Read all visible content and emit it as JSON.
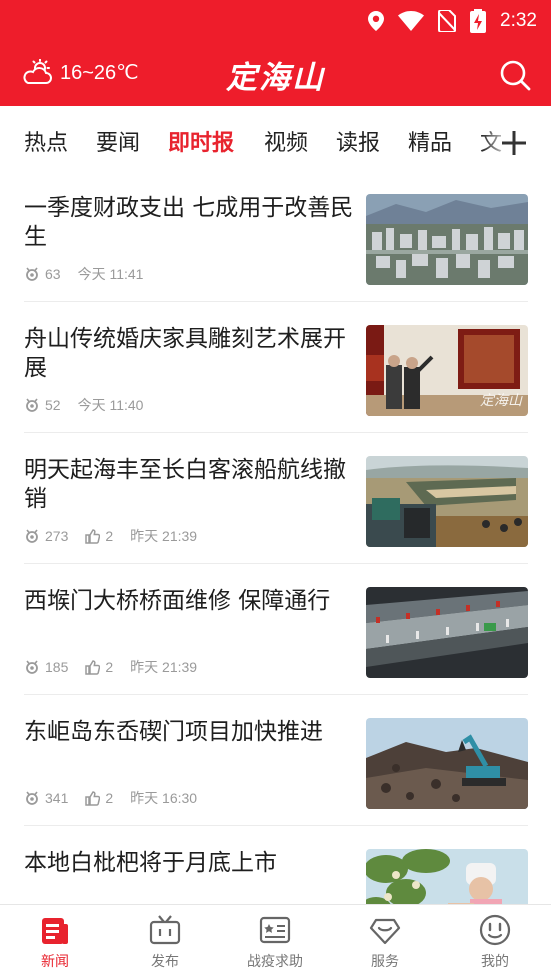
{
  "status_bar": {
    "time": "2:32"
  },
  "header": {
    "weather_text": "16~26℃",
    "brand": "定海山",
    "search_icon": "search-icon"
  },
  "tabs": [
    {
      "label": "热点",
      "active": false
    },
    {
      "label": "要闻",
      "active": false
    },
    {
      "label": "即时报",
      "active": true
    },
    {
      "label": "视频",
      "active": false
    },
    {
      "label": "读报",
      "active": false
    },
    {
      "label": "精品",
      "active": false
    },
    {
      "label": "文",
      "active": false
    }
  ],
  "feed": [
    {
      "title": "一季度财政支出 七成用于改善民生",
      "views": "63",
      "likes": null,
      "time": "今天 11:41",
      "thumb": "city-aerial-photo"
    },
    {
      "title": "舟山传统婚庆家具雕刻艺术展开展",
      "views": "52",
      "likes": null,
      "time": "今天 11:40",
      "thumb": "exhibition-photo",
      "watermark": "定海山"
    },
    {
      "title": "明天起海丰至长白客滚船航线撤销",
      "views": "273",
      "likes": "2",
      "time": "昨天 21:39",
      "thumb": "ferry-photo"
    },
    {
      "title": "西堠门大桥桥面维修 保障通行",
      "views": "185",
      "likes": "2",
      "time": "昨天 21:39",
      "thumb": "bridge-photo"
    },
    {
      "title": "东岠岛东岙碶门项目加快推进",
      "views": "341",
      "likes": "2",
      "time": "昨天 16:30",
      "thumb": "excavator-photo"
    },
    {
      "title": "本地白枇杷将于月底上市",
      "views": "",
      "likes": null,
      "time": "",
      "thumb": "loquat-photo"
    }
  ],
  "bottom_nav": [
    {
      "label": "新闻",
      "icon": "news-icon",
      "active": true
    },
    {
      "label": "发布",
      "icon": "tv-icon",
      "active": false
    },
    {
      "label": "战疫求助",
      "icon": "id-card-icon",
      "active": false
    },
    {
      "label": "服务",
      "icon": "heart-diamond-icon",
      "active": false
    },
    {
      "label": "我的",
      "icon": "smiley-icon",
      "active": false
    }
  ],
  "colors": {
    "brand_red": "#ee1d2b",
    "active_red": "#e8232e",
    "meta_gray": "#9a9a9a"
  }
}
